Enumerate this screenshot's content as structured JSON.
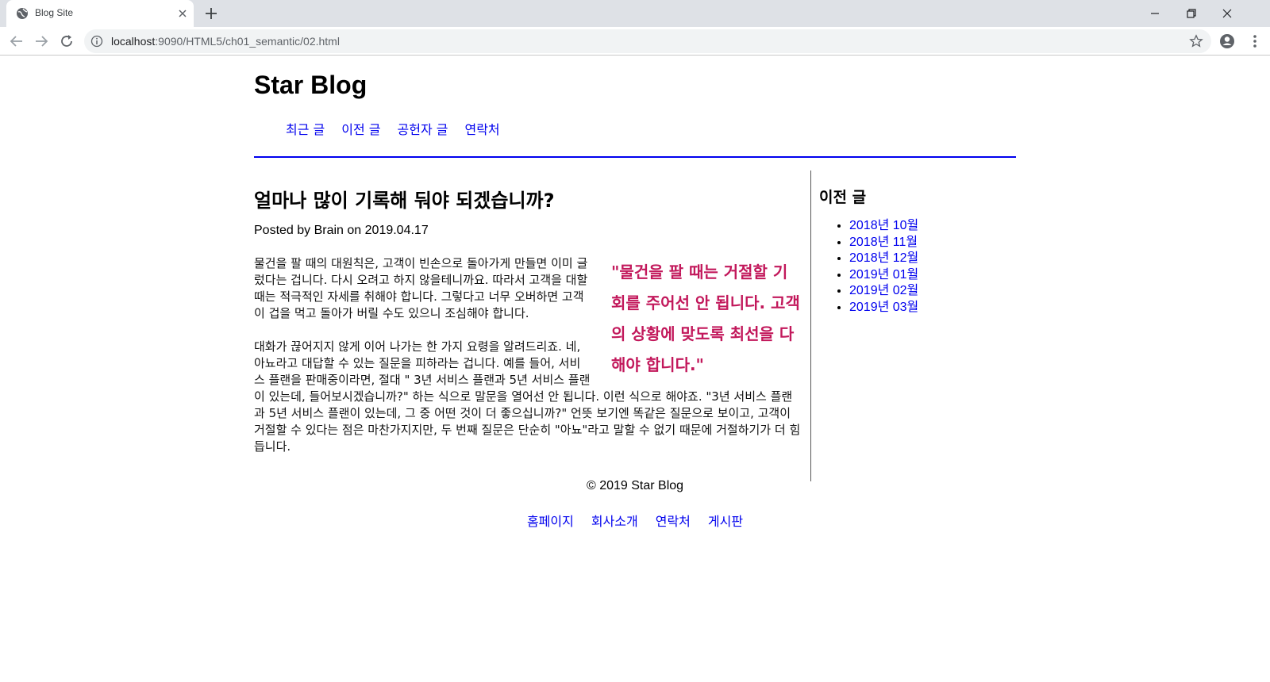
{
  "browser": {
    "tab_title": "Blog Site",
    "url_host": "localhost",
    "url_rest": ":9090/HTML5/ch01_semantic/02.html"
  },
  "site": {
    "title": "Star Blog",
    "nav": [
      "최근 글",
      "이전 글",
      "공헌자 글",
      "연락처"
    ]
  },
  "article": {
    "title": "얼마나 많이 기록해 둬야 되겠습니까?",
    "meta": "Posted by Brain on 2019.04.17",
    "quote": "\"물건을 팔 때는 거절할 기회를 주어선 안 됩니다. 고객의 상황에 맞도록 최선을 다해야 합니다.\"",
    "paragraphs": [
      "물건을 팔 때의 대원칙은, 고객이 빈손으로 돌아가게 만들면 이미 글렀다는 겁니다. 다시 오려고 하지 않을테니까요. 따라서 고객을 대할 때는 적극적인 자세를 취해야 합니다. 그렇다고 너무 오버하면 고객이 겁을 먹고 돌아가 버릴 수도 있으니 조심해야 합니다.",
      "대화가 끊어지지 않게 이어 나가는 한 가지 요령을 알려드리죠. 네, 아뇨라고 대답할 수 있는 질문을 피하라는 겁니다. 예를 들어, 서비스 플랜을 판매중이라면, 절대 \" 3년 서비스 플랜과 5년 서비스 플랜이 있는데, 들어보시겠습니까?\" 하는 식으로 말문을 열어선 안 됩니다. 이런 식으로 해야죠. \"3년 서비스 플랜과 5년 서비스 플랜이 있는데, 그 중 어떤 것이 더 좋으십니까?\" 언뜻 보기엔 똑같은 질문으로 보이고, 고객이 거절할 수 있다는 점은 마찬가지지만, 두 번째 질문은 단순히 \"아뇨\"라고 말할 수 없기 때문에 거절하기가 더 힘듭니다."
    ]
  },
  "aside": {
    "title": "이전 글",
    "archive": [
      "2018년 10월",
      "2018년 11월",
      "2018년 12월",
      "2019년 01월",
      "2019년 02월",
      "2019년 03월"
    ]
  },
  "footer": {
    "copyright": "© 2019 Star Blog",
    "nav": [
      "홈페이지",
      "회사소개",
      "연락처",
      "게시판"
    ]
  },
  "colors": {
    "link": "#0000ee",
    "quote": "#c2185b",
    "nav_rule": "#0000ee"
  }
}
